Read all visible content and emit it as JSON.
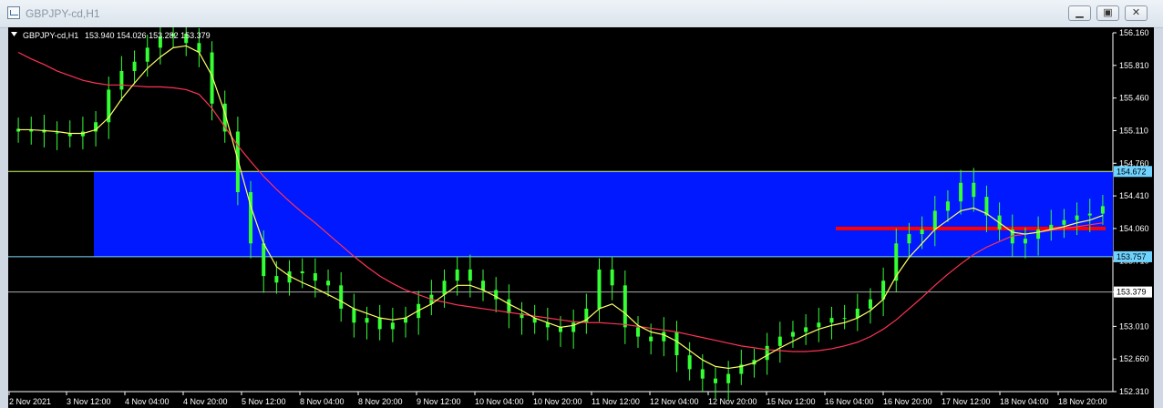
{
  "window": {
    "title": "GBPJPY-cd,H1",
    "buttons": {
      "minimize_icon": "minimize-icon",
      "maximize_icon": "maximize-icon",
      "close_icon": "close-icon"
    }
  },
  "header": {
    "symbol": "GBPJPY-cd,H1",
    "ohlc": "153.940 154.026 153.282 153.379"
  },
  "chart_data": {
    "type": "candlestick",
    "colors": {
      "background": "#000000",
      "candles": "#33ff33",
      "ma_fast": "#ffff66",
      "ma_slow": "#ff3355",
      "zone": "#0019ff",
      "level_line": "#ff0000",
      "price_label_blue": "#6fd3ff"
    },
    "ylim": [
      152.31,
      156.16
    ],
    "x": [
      "2 Nov 2021",
      "3 Nov 12:00",
      "4 Nov 04:00",
      "4 Nov 20:00",
      "5 Nov 12:00",
      "8 Nov 04:00",
      "8 Nov 20:00",
      "9 Nov 12:00",
      "10 Nov 04:00",
      "10 Nov 20:00",
      "11 Nov 12:00",
      "12 Nov 04:00",
      "12 Nov 20:00",
      "15 Nov 12:00",
      "16 Nov 04:00",
      "16 Nov 20:00",
      "17 Nov 12:00",
      "18 Nov 04:00",
      "18 Nov 20:00"
    ],
    "y_ticks": [
      "156.160",
      "155.810",
      "155.460",
      "155.110",
      "154.760",
      "154.410",
      "154.060",
      "153.710",
      "153.379",
      "153.010",
      "152.660",
      "152.310"
    ],
    "price_labels": [
      "154.672",
      "153.757",
      "153.379"
    ],
    "levels": {
      "zone_top": 154.672,
      "zone_bottom": 153.757,
      "current": 153.379,
      "red_line": 154.06
    },
    "close_series": [
      155.1,
      155.12,
      155.09,
      155.08,
      155.05,
      155.1,
      155.2,
      155.55,
      155.75,
      155.85,
      156.0,
      156.12,
      156.15,
      156.05,
      155.95,
      155.4,
      155.1,
      154.45,
      153.9,
      153.55,
      153.48,
      153.6,
      153.58,
      153.5,
      153.45,
      153.2,
      153.05,
      153.1,
      152.98,
      153.05,
      153.1,
      153.25,
      153.35,
      153.5,
      153.62,
      153.5,
      153.4,
      153.3,
      153.15,
      153.1,
      153.05,
      153.0,
      152.95,
      153.05,
      153.2,
      153.62,
      153.45,
      153.0,
      152.9,
      152.85,
      152.95,
      152.7,
      152.55,
      152.45,
      152.4,
      152.5,
      152.6,
      152.65,
      152.8,
      152.9,
      152.95,
      153.0,
      153.05,
      153.1,
      153.1,
      153.2,
      153.3,
      153.5,
      153.9,
      154.0,
      154.05,
      154.25,
      154.35,
      154.55,
      154.4,
      154.2,
      154.05,
      153.9,
      153.95,
      154.05,
      154.1,
      154.15,
      154.2,
      154.22,
      154.3
    ],
    "ma_fast_series": [
      155.12,
      155.12,
      155.11,
      155.1,
      155.08,
      155.08,
      155.12,
      155.25,
      155.45,
      155.62,
      155.78,
      155.9,
      156.0,
      156.02,
      155.95,
      155.7,
      155.3,
      154.8,
      154.3,
      153.9,
      153.65,
      153.55,
      153.48,
      153.42,
      153.35,
      153.28,
      153.2,
      153.15,
      153.1,
      153.08,
      153.1,
      153.18,
      153.25,
      153.35,
      153.45,
      153.45,
      153.4,
      153.33,
      153.25,
      153.18,
      153.1,
      153.05,
      153.0,
      153.02,
      153.08,
      153.2,
      153.25,
      153.15,
      153.02,
      152.95,
      152.92,
      152.85,
      152.75,
      152.65,
      152.58,
      152.56,
      152.58,
      152.62,
      152.7,
      152.78,
      152.85,
      152.92,
      152.98,
      153.02,
      153.05,
      153.1,
      153.18,
      153.3,
      153.55,
      153.75,
      153.9,
      154.05,
      154.15,
      154.25,
      154.28,
      154.22,
      154.12,
      154.02,
      154.0,
      154.02,
      154.05,
      154.08,
      154.12,
      154.15,
      154.2
    ],
    "ma_slow_series": [
      155.95,
      155.88,
      155.82,
      155.75,
      155.7,
      155.65,
      155.62,
      155.6,
      155.6,
      155.59,
      155.58,
      155.58,
      155.57,
      155.55,
      155.5,
      155.35,
      155.15,
      154.95,
      154.78,
      154.62,
      154.48,
      154.35,
      154.23,
      154.12,
      154.0,
      153.88,
      153.76,
      153.65,
      153.55,
      153.47,
      153.4,
      153.35,
      153.3,
      153.27,
      153.24,
      153.22,
      153.2,
      153.18,
      153.16,
      153.14,
      153.12,
      153.1,
      153.08,
      153.06,
      153.05,
      153.05,
      153.04,
      153.03,
      153.01,
      152.99,
      152.97,
      152.95,
      152.92,
      152.89,
      152.86,
      152.83,
      152.8,
      152.78,
      152.76,
      152.75,
      152.74,
      152.74,
      152.75,
      152.77,
      152.8,
      152.84,
      152.9,
      152.98,
      153.08,
      153.2,
      153.32,
      153.45,
      153.57,
      153.68,
      153.78,
      153.86,
      153.92,
      153.98,
      154.0,
      154.02,
      154.04,
      154.06,
      154.08,
      154.1,
      154.12
    ]
  }
}
